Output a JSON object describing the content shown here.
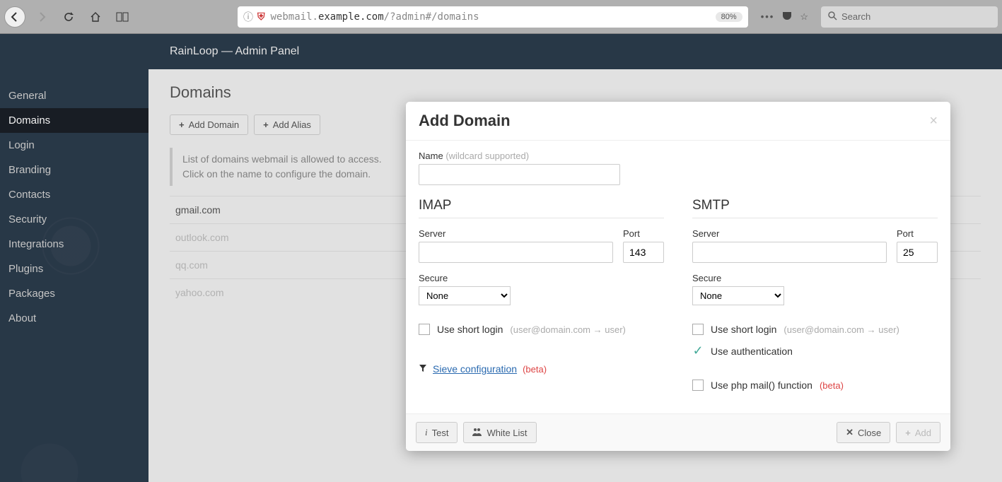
{
  "browser": {
    "url_pre": "webmail.",
    "url_host": "example.com",
    "url_path": "/?admin#/domains",
    "zoom": "80%",
    "search_placeholder": "Search"
  },
  "header": {
    "title": "RainLoop — Admin Panel"
  },
  "sidebar": {
    "items": [
      {
        "label": "General"
      },
      {
        "label": "Domains"
      },
      {
        "label": "Login"
      },
      {
        "label": "Branding"
      },
      {
        "label": "Contacts"
      },
      {
        "label": "Security"
      },
      {
        "label": "Integrations"
      },
      {
        "label": "Plugins"
      },
      {
        "label": "Packages"
      },
      {
        "label": "About"
      }
    ]
  },
  "page": {
    "title": "Domains",
    "add_domain": "Add Domain",
    "add_alias": "Add Alias",
    "info1": "List of domains webmail is allowed to access.",
    "info2": "Click on the name to configure the domain.",
    "domains": [
      {
        "name": "gmail.com",
        "enabled": true
      },
      {
        "name": "outlook.com",
        "enabled": false
      },
      {
        "name": "qq.com",
        "enabled": false
      },
      {
        "name": "yahoo.com",
        "enabled": false
      }
    ]
  },
  "modal": {
    "title": "Add Domain",
    "name_label": "Name",
    "name_hint": "(wildcard supported)",
    "imap": {
      "title": "IMAP",
      "server_label": "Server",
      "port_label": "Port",
      "port_value": "143",
      "secure_label": "Secure",
      "secure_value": "None",
      "short_login": "Use short login",
      "short_hint": "(user@domain.com → user)",
      "sieve_link": "Sieve configuration",
      "sieve_beta": "(beta)"
    },
    "smtp": {
      "title": "SMTP",
      "server_label": "Server",
      "port_label": "Port",
      "port_value": "25",
      "secure_label": "Secure",
      "secure_value": "None",
      "short_login": "Use short login",
      "short_hint": "(user@domain.com → user)",
      "use_auth": "Use authentication",
      "php_mail": "Use php mail() function",
      "php_beta": "(beta)"
    },
    "footer": {
      "test": "Test",
      "whitelist": "White List",
      "close": "Close",
      "add": "Add"
    }
  }
}
